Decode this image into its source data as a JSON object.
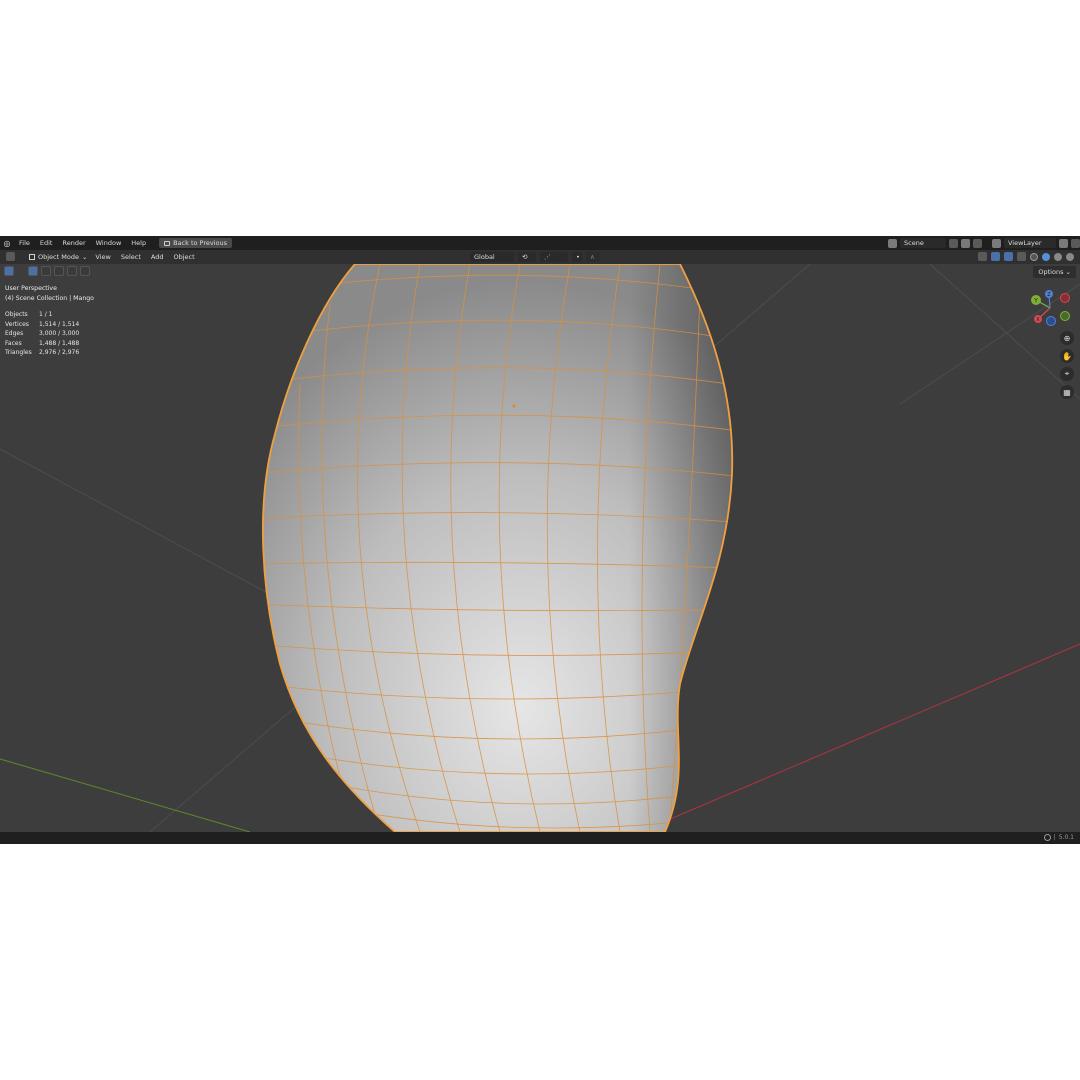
{
  "menubar": {
    "logo_icon": "blender-logo-icon",
    "items": [
      "File",
      "Edit",
      "Render",
      "Window",
      "Help"
    ],
    "back_button": "Back to Previous",
    "scene": "Scene",
    "view_layer": "ViewLayer"
  },
  "header": {
    "mode": "Object Mode",
    "menus": [
      "View",
      "Select",
      "Add",
      "Object"
    ],
    "orientation": "Global",
    "options": "Options"
  },
  "overlay": {
    "perspective": "User Perspective",
    "collection": "(4) Scene Collection | Mango"
  },
  "stats": [
    {
      "label": "Objects",
      "value": "1 / 1"
    },
    {
      "label": "Vertices",
      "value": "1,514 / 1,514"
    },
    {
      "label": "Edges",
      "value": "3,000 / 3,000"
    },
    {
      "label": "Faces",
      "value": "1,488 / 1,488"
    },
    {
      "label": "Triangles",
      "value": "2,976 / 2,976"
    }
  ],
  "gizmo": {
    "x": "X",
    "y": "Y",
    "z": "Z"
  },
  "status": {
    "version": "5.0.1"
  },
  "colors": {
    "background": "#3d3d3d",
    "selection_outline": "#f0a040",
    "wire": "#d9913f",
    "x_axis": "#c43b47",
    "y_axis": "#6a9a2e",
    "z_axis": "#3b6fc4"
  }
}
